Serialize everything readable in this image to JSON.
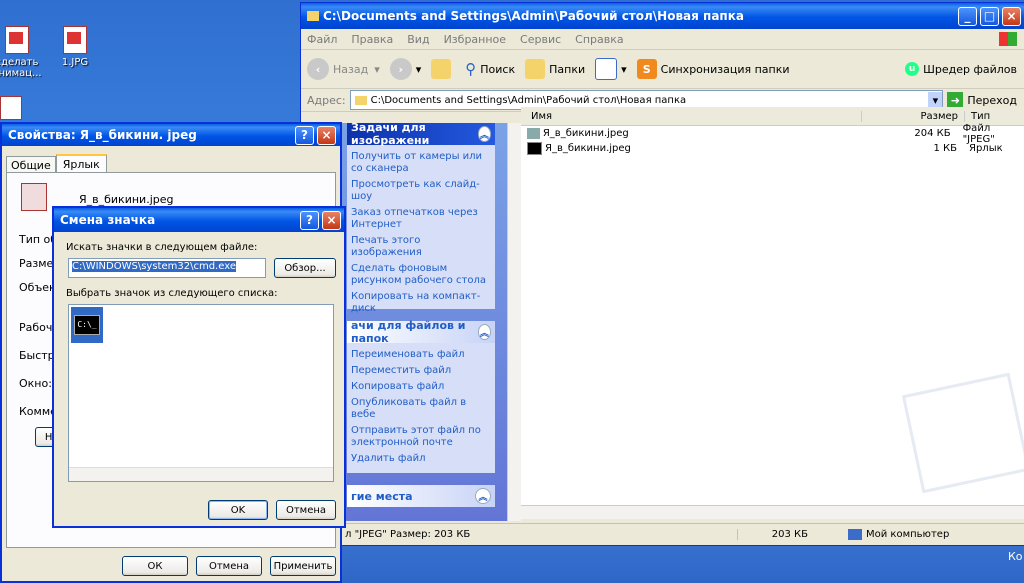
{
  "desktop": {
    "icons": [
      {
        "label": "сделать\nанимац..."
      },
      {
        "label": "1.JPG"
      }
    ],
    "corner_text": "Ко"
  },
  "explorer": {
    "title": "C:\\Documents and Settings\\Admin\\Рабочий стол\\Новая папка",
    "menu": [
      "Файл",
      "Правка",
      "Вид",
      "Избранное",
      "Сервис",
      "Справка"
    ],
    "toolbar": {
      "back": "Назад",
      "search": "Поиск",
      "folders": "Папки",
      "sync": "Синхронизация папки",
      "shredder": "Шредер файлов"
    },
    "address": {
      "label": "Адрес:",
      "value": "C:\\Documents and Settings\\Admin\\Рабочий стол\\Новая папка",
      "go": "Переход"
    },
    "taskpane": {
      "image_tasks": {
        "title": "Задачи для изображени",
        "links": [
          "Получить от камеры или со сканера",
          "Просмотреть как слайд-шоу",
          "Заказ отпечатков через Интернет",
          "Печать этого изображения",
          "Сделать фоновым рисунком рабочего стола",
          "Копировать на компакт-диск"
        ]
      },
      "file_tasks": {
        "title": "ачи для файлов и папок",
        "links": [
          "Переименовать файл",
          "Переместить файл",
          "Копировать файл",
          "Опубликовать файл в вебе",
          "Отправить этот файл по электронной почте",
          "Удалить файл"
        ]
      },
      "other_places": {
        "title": "гие места"
      }
    },
    "columns": {
      "name": "Имя",
      "size": "Размер",
      "type": "Тип"
    },
    "files": [
      {
        "name": "Я_в_бикини.jpeg",
        "size": "204 КБ",
        "type": "Файл \"JPEG\""
      },
      {
        "name": "Я_в_бикини.jpeg",
        "size": "1 КБ",
        "type": "Ярлык"
      }
    ],
    "status": {
      "left": "л \"JPEG\" Размер: 203 КБ",
      "size": "203 КБ",
      "location": "Мой компьютер"
    }
  },
  "properties": {
    "title": "Свойства: Я_в_бикини. jpeg",
    "tabs": [
      "Общие",
      "Ярлык"
    ],
    "filename": "Я_в_бикини.jpeg",
    "rows": [
      "Тип об",
      "Размещ",
      "Объект",
      "Рабочая",
      "Быстры",
      "Окно:",
      "Коммент"
    ],
    "partial_button": "Най",
    "buttons": {
      "ok": "ОК",
      "cancel": "Отмена",
      "apply": "Применить"
    }
  },
  "change_icon": {
    "title": "Смена значка",
    "search_label": "Искать значки в следующем файле:",
    "file_value": "C:\\WINDOWS\\system32\\cmd.exe",
    "browse": "Обзор...",
    "list_label": "Выбрать значок из следующего списка:",
    "icon_glyph": "C:\\_",
    "buttons": {
      "ok": "OK",
      "cancel": "Отмена"
    }
  }
}
